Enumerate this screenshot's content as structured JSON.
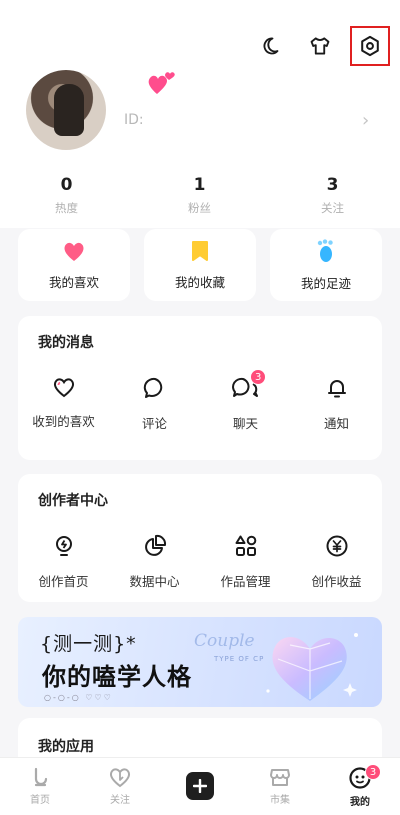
{
  "profile": {
    "id_label": "ID:",
    "stats": [
      {
        "value": "0",
        "label": "热度"
      },
      {
        "value": "1",
        "label": "粉丝"
      },
      {
        "value": "3",
        "label": "关注"
      }
    ]
  },
  "top_icons": [
    "moon-icon",
    "shirt-icon",
    "settings-icon"
  ],
  "quick_actions": [
    {
      "label": "我的喜欢",
      "icon": "heart-icon",
      "color": "#ff5c86"
    },
    {
      "label": "我的收藏",
      "icon": "bookmark-icon",
      "color": "#ffcc33"
    },
    {
      "label": "我的足迹",
      "icon": "footprint-icon",
      "color": "#36b6ff"
    }
  ],
  "messages": {
    "title": "我的消息",
    "items": [
      {
        "label": "收到的喜欢",
        "icon": "heart-outline-icon"
      },
      {
        "label": "评论",
        "icon": "comment-icon"
      },
      {
        "label": "聊天",
        "icon": "chat-icon",
        "badge": "3"
      },
      {
        "label": "通知",
        "icon": "bell-icon"
      }
    ]
  },
  "creator": {
    "title": "创作者中心",
    "items": [
      {
        "label": "创作首页",
        "icon": "bulb-icon"
      },
      {
        "label": "数据中心",
        "icon": "pie-chart-icon"
      },
      {
        "label": "作品管理",
        "icon": "grid-icon"
      },
      {
        "label": "创作收益",
        "icon": "yuan-icon"
      }
    ]
  },
  "banner": {
    "line1": "{测一测}*",
    "line2": "你的嗑学人格",
    "script": "Couple",
    "sub": "TYPE OF CP",
    "dots": "○-○-○ ♡♡♡"
  },
  "apps": {
    "title": "我的应用"
  },
  "tabbar": [
    {
      "label": "首页",
      "icon": "home-icon"
    },
    {
      "label": "关注",
      "icon": "follow-icon"
    },
    {
      "label": "",
      "icon": "plus-icon"
    },
    {
      "label": "市集",
      "icon": "market-icon"
    },
    {
      "label": "我的",
      "icon": "me-icon",
      "badge": "3",
      "active": true
    }
  ],
  "colors": {
    "accent_badge": "#ff4d7a",
    "highlight": "#e02020"
  }
}
